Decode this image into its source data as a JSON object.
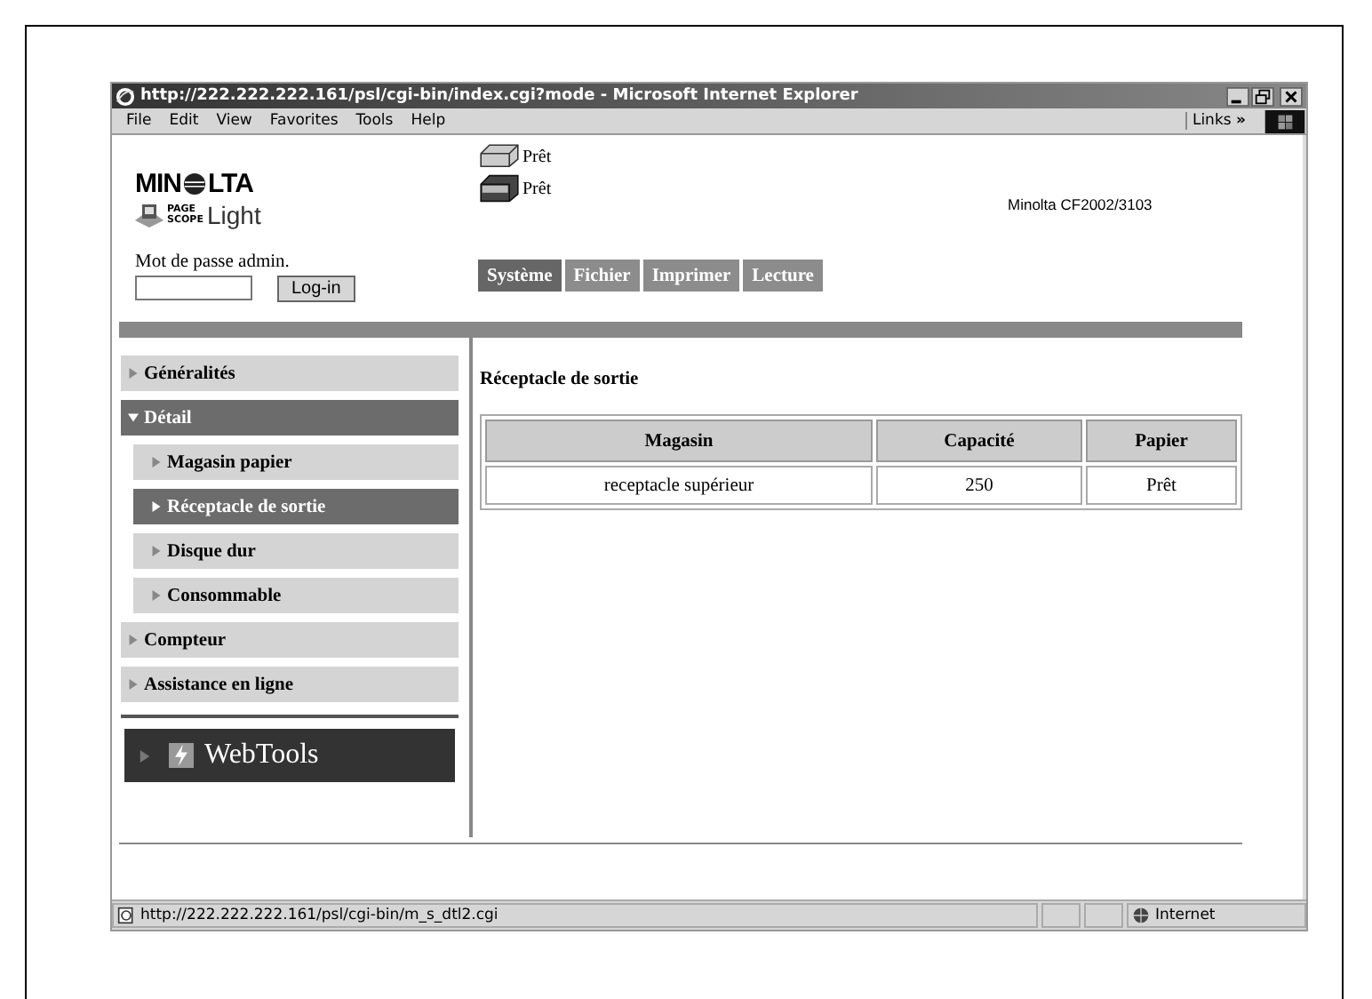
{
  "window": {
    "title": "http://222.222.222.161/psl/cgi-bin/index.cgi?mode - Microsoft Internet Explorer"
  },
  "menu": [
    "File",
    "Edit",
    "View",
    "Favorites",
    "Tools",
    "Help"
  ],
  "links": {
    "label": "Links",
    "more": "»"
  },
  "logo": {
    "left": "MIN",
    "right": "LTA",
    "page": "PAGE",
    "scope": "SCOPE",
    "light": "Light"
  },
  "printers": [
    {
      "status": "Prêt"
    },
    {
      "status": "Prêt"
    }
  ],
  "model": "Minolta CF2002/3103",
  "login": {
    "label": "Mot de passe admin.",
    "button": "Log-in"
  },
  "tabs": [
    {
      "label": "Système",
      "selected": true
    },
    {
      "label": "Fichier",
      "selected": false
    },
    {
      "label": "Imprimer",
      "selected": false
    },
    {
      "label": "Lecture",
      "selected": false
    }
  ],
  "sidebar": {
    "items": [
      {
        "label": "Généralités",
        "expanded": false
      },
      {
        "label": "Détail",
        "expanded": true,
        "children": [
          {
            "label": "Magasin papier",
            "selected": false
          },
          {
            "label": "Réceptacle de sortie",
            "selected": true
          },
          {
            "label": "Disque dur",
            "selected": false
          },
          {
            "label": "Consommable",
            "selected": false
          }
        ]
      },
      {
        "label": "Compteur",
        "expanded": false
      },
      {
        "label": "Assistance en ligne",
        "expanded": false
      }
    ],
    "webtools": "WebTools"
  },
  "content": {
    "title": "Réceptacle de sortie",
    "table": {
      "columns": [
        "Magasin",
        "Capacité",
        "Papier"
      ],
      "rows": [
        [
          "receptacle supérieur",
          "250",
          "Prêt"
        ]
      ]
    }
  },
  "status_bar": {
    "url": "http://222.222.222.161/psl/cgi-bin/m_s_dtl2.cgi",
    "zone": "Internet"
  }
}
